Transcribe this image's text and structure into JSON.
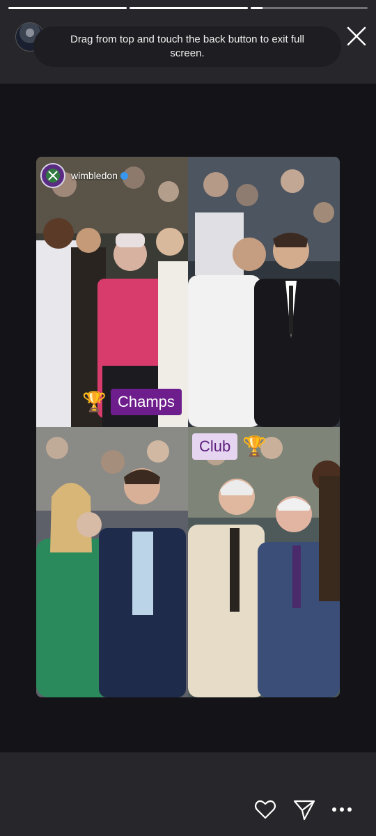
{
  "progress": [
    {
      "fill": 1.0
    },
    {
      "fill": 1.0
    },
    {
      "fill": 0.1
    }
  ],
  "toast": {
    "message": "Drag from top and touch the back button to exit full screen."
  },
  "post": {
    "account": "wimbledon",
    "stickers": {
      "champs": "Champs",
      "club": "Club"
    },
    "trophy_glyph": "🏆"
  },
  "icons": {
    "close": "close-icon",
    "like": "heart-icon",
    "share": "send-icon",
    "more": "more-icon"
  },
  "colors": {
    "accent_purple": "#6d1d8c",
    "club_sticker_bg": "#e6d5f0",
    "brand_purple": "#5a2b82"
  }
}
